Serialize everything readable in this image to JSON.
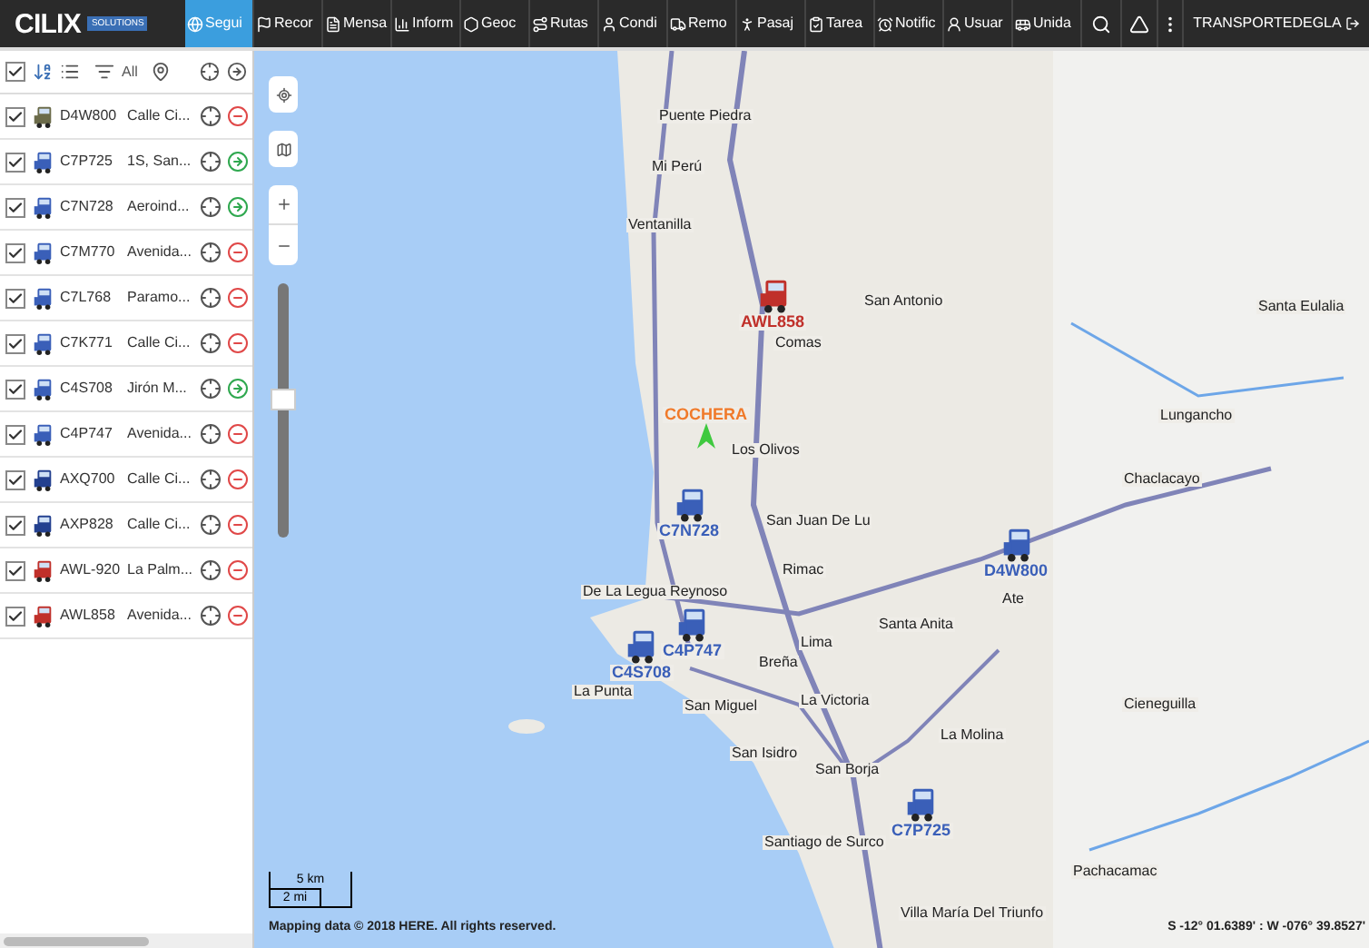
{
  "topbar": {
    "logo": "CILIX",
    "logo_sub": "SOLUTIONS",
    "tabs": [
      {
        "label": "Segui",
        "selected": true
      },
      {
        "label": "Recor",
        "selected": false
      },
      {
        "label": "Mensa",
        "selected": false
      },
      {
        "label": "Inform",
        "selected": false
      },
      {
        "label": "Geoc",
        "selected": false
      },
      {
        "label": "Rutas",
        "selected": false
      },
      {
        "label": "Condi",
        "selected": false
      },
      {
        "label": "Remo",
        "selected": false
      },
      {
        "label": "Pasaj",
        "selected": false
      },
      {
        "label": "Tarea",
        "selected": false
      },
      {
        "label": "Notific",
        "selected": false
      },
      {
        "label": "Usuar",
        "selected": false
      },
      {
        "label": "Unida",
        "selected": false
      }
    ],
    "user": "TRANSPORTEDEGLA"
  },
  "sidebar": {
    "all_checked": true,
    "all_label": "All",
    "vehicles": [
      {
        "plate": "D4W800",
        "address": "Calle Ci...",
        "checked": true,
        "color": "#6b6b4a",
        "kind": "stopped"
      },
      {
        "plate": "C7P725",
        "address": "1S, San...",
        "checked": true,
        "color": "#3a5fb8",
        "kind": "moving"
      },
      {
        "plate": "C7N728",
        "address": "Aeroind...",
        "checked": true,
        "color": "#3a5fb8",
        "kind": "moving"
      },
      {
        "plate": "C7M770",
        "address": "Avenida...",
        "checked": true,
        "color": "#3a5fb8",
        "kind": "stopped"
      },
      {
        "plate": "C7L768",
        "address": "Paramo...",
        "checked": true,
        "color": "#3a5fb8",
        "kind": "stopped"
      },
      {
        "plate": "C7K771",
        "address": "Calle Ci...",
        "checked": true,
        "color": "#3a5fb8",
        "kind": "stopped"
      },
      {
        "plate": "C4S708",
        "address": "Jirón M...",
        "checked": true,
        "color": "#3a5fb8",
        "kind": "moving"
      },
      {
        "plate": "C4P747",
        "address": "Avenida...",
        "checked": true,
        "color": "#3a5fb8",
        "kind": "stopped"
      },
      {
        "plate": "AXQ700",
        "address": "Calle Ci...",
        "checked": true,
        "color": "#23408f",
        "kind": "stopped"
      },
      {
        "plate": "AXP828",
        "address": "Calle Ci...",
        "checked": true,
        "color": "#23408f",
        "kind": "stopped"
      },
      {
        "plate": "AWL-920",
        "address": "La Palm...",
        "checked": true,
        "color": "#c0302a",
        "kind": "stopped"
      },
      {
        "plate": "AWL858",
        "address": "Avenida...",
        "checked": true,
        "color": "#c0302a",
        "kind": "stopped"
      }
    ]
  },
  "map": {
    "places": [
      {
        "name": "Puente Piedra"
      },
      {
        "name": "Mi Perú"
      },
      {
        "name": "Ventanilla"
      },
      {
        "name": "San Antonio"
      },
      {
        "name": "Comas"
      },
      {
        "name": "Santa Eulalia"
      },
      {
        "name": "Los Olivos"
      },
      {
        "name": "Lungancho"
      },
      {
        "name": "San Juan De Lu"
      },
      {
        "name": "Chaclacayo"
      },
      {
        "name": "Rimac"
      },
      {
        "name": "Ate"
      },
      {
        "name": "Santa Anita"
      },
      {
        "name": "De La Legua Reynoso"
      },
      {
        "name": "Lima"
      },
      {
        "name": "Breña"
      },
      {
        "name": "La Punta"
      },
      {
        "name": "San Miguel"
      },
      {
        "name": "La Victoria"
      },
      {
        "name": "La Molina"
      },
      {
        "name": "Cieneguilla"
      },
      {
        "name": "San Isidro"
      },
      {
        "name": "San Borja"
      },
      {
        "name": "Santiago de Surco"
      },
      {
        "name": "Villa María Del Triunfo"
      },
      {
        "name": "Pachacamac"
      }
    ],
    "markers": [
      {
        "label": "AWL858",
        "kind": "truck",
        "color": "#c0302a"
      },
      {
        "label": "COCHERA",
        "kind": "poi",
        "color": "#f07a2a"
      },
      {
        "label": "C7N728",
        "kind": "truck",
        "color": "#3a5fb8"
      },
      {
        "label": "D4W800",
        "kind": "truck",
        "color": "#3a5fb8"
      },
      {
        "label": "C4P747",
        "kind": "truck",
        "color": "#3a5fb8"
      },
      {
        "label": "C4S708",
        "kind": "truck",
        "color": "#3a5fb8"
      },
      {
        "label": "C7P725",
        "kind": "truck",
        "color": "#3a5fb8"
      }
    ],
    "zoom_slider": {
      "level": 0.55
    },
    "scale": [
      "5 km",
      "2 mi"
    ],
    "attribution": "Mapping data © 2018 HERE. All rights reserved.",
    "coordinates": "S -12° 01.6389' : W -076° 39.8527'"
  }
}
